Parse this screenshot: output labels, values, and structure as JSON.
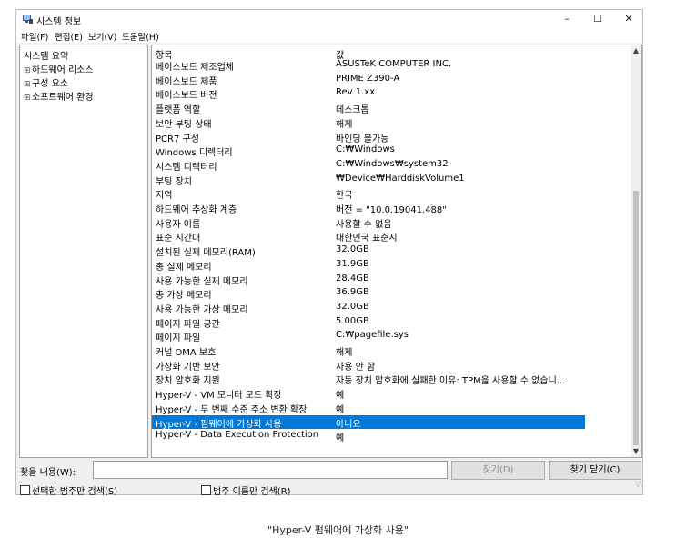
{
  "window": {
    "title": "시스템 정보",
    "controls": {
      "minimize": "–",
      "maximize": "☐",
      "close": "✕"
    }
  },
  "menu": [
    "파일(F)",
    "편집(E)",
    "보기(V)",
    "도움말(H)"
  ],
  "tree": [
    {
      "label": "시스템 요약",
      "expander": ""
    },
    {
      "label": "하드웨어 리소스",
      "expander": "⊞"
    },
    {
      "label": "구성 요소",
      "expander": "⊞"
    },
    {
      "label": "소프트웨어 환경",
      "expander": "⊞"
    }
  ],
  "table": {
    "headers": [
      "항목",
      "값"
    ],
    "rows": [
      [
        "베이스보드 제조업체",
        "ASUSTeK COMPUTER INC."
      ],
      [
        "베이스보드 제품",
        "PRIME Z390-A"
      ],
      [
        "베이스보드 버전",
        "Rev 1.xx"
      ],
      [
        "플랫폼 역할",
        "데스크톱"
      ],
      [
        "보안 부팅 상태",
        "해제"
      ],
      [
        "PCR7 구성",
        "바인딩 불가능"
      ],
      [
        "Windows 디렉터리",
        "C:₩Windows"
      ],
      [
        "시스템 디렉터리",
        "C:₩Windows₩system32"
      ],
      [
        "부팅 장치",
        "₩Device₩HarddiskVolume1"
      ],
      [
        "지역",
        "한국"
      ],
      [
        "하드웨어 추상화 계층",
        "버전 = \"10.0.19041.488\""
      ],
      [
        "사용자 이름",
        "사용할 수 없음"
      ],
      [
        "표준 시간대",
        "대한민국 표준시"
      ],
      [
        "설치된 실제 메모리(RAM)",
        "32.0GB"
      ],
      [
        "총 실제 메모리",
        "31.9GB"
      ],
      [
        "사용 가능한 실제 메모리",
        "28.4GB"
      ],
      [
        "총 가상 메모리",
        "36.9GB"
      ],
      [
        "사용 가능한 가상 메모리",
        "32.0GB"
      ],
      [
        "페이지 파일 공간",
        "5.00GB"
      ],
      [
        "페이지 파일",
        "C:₩pagefile.sys"
      ],
      [
        "커널 DMA 보호",
        "해제"
      ],
      [
        "가상화 기반 보안",
        "사용 안 함"
      ],
      [
        "장치 암호화 지원",
        "자동 장치 암호화에 실패한 이유: TPM을 사용할 수 없습니..."
      ],
      [
        "Hyper-V - VM 모니터 모드 확장",
        "예"
      ],
      [
        "Hyper-V - 두 번째 수준 주소 변환 확장",
        "예"
      ],
      [
        "Hyper-V - 펌웨어에 가상화 사용",
        "아니요"
      ],
      [
        "Hyper-V - Data Execution Protection",
        "예"
      ]
    ],
    "selected_index": 25
  },
  "find": {
    "label": "찾을 내용(W):",
    "value": "",
    "find_button": "찾기(D)",
    "close_button": "찾기 닫기(C)"
  },
  "options": {
    "selected_category_only": "선택한 범주만 검색(S)",
    "category_names_only": "범주 이름만 검색(R)"
  },
  "caption": "\"Hyper-V 펌웨어에 가상화 사용\"",
  "watermark": "W",
  "colors": {
    "selection": "#0078d7",
    "window_bg": "#f0f0f0"
  }
}
